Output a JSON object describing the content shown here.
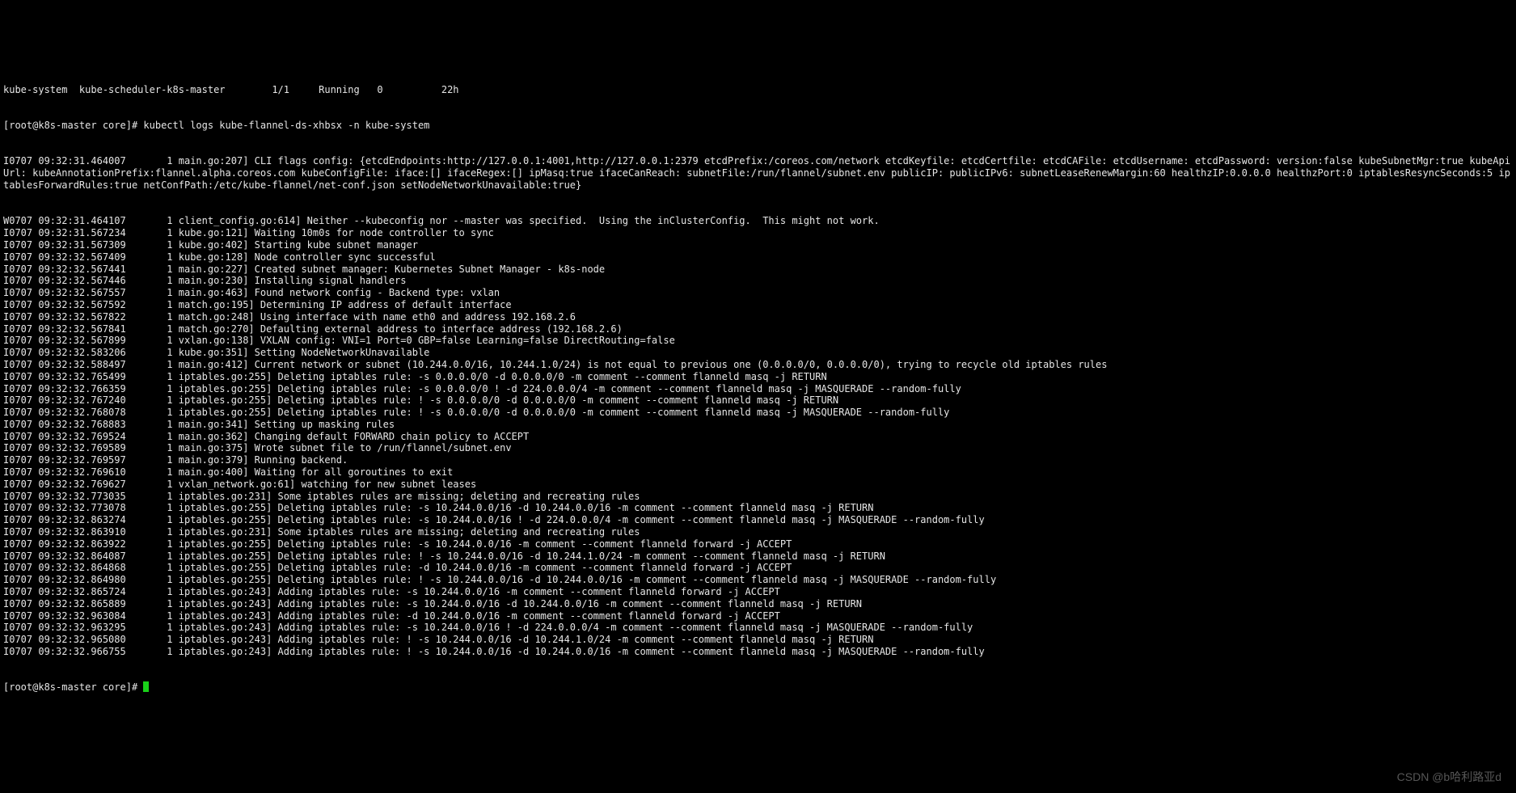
{
  "header": {
    "top_line": "kube-system  kube-scheduler-k8s-master        1/1     Running   0          22h",
    "prompt_command": "[root@k8s-master core]# kubectl logs kube-flannel-ds-xhbsx -n kube-system"
  },
  "cli_flags_block": "I0707 09:32:31.464007       1 main.go:207] CLI flags config: {etcdEndpoints:http://127.0.0.1:4001,http://127.0.0.1:2379 etcdPrefix:/coreos.com/network etcdKeyfile: etcdCertfile: etcdCAFile: etcdUsername: etcdPassword: version:false kubeSubnetMgr:true kubeApiUrl: kubeAnnotationPrefix:flannel.alpha.coreos.com kubeConfigFile: iface:[] ifaceRegex:[] ipMasq:true ifaceCanReach: subnetFile:/run/flannel/subnet.env publicIP: publicIPv6: subnetLeaseRenewMargin:60 healthzIP:0.0.0.0 healthzPort:0 iptablesResyncSeconds:5 iptablesForwardRules:true netConfPath:/etc/kube-flannel/net-conf.json setNodeNetworkUnavailable:true}",
  "log_lines": [
    "W0707 09:32:31.464107       1 client_config.go:614] Neither --kubeconfig nor --master was specified.  Using the inClusterConfig.  This might not work.",
    "I0707 09:32:31.567234       1 kube.go:121] Waiting 10m0s for node controller to sync",
    "I0707 09:32:31.567309       1 kube.go:402] Starting kube subnet manager",
    "I0707 09:32:32.567409       1 kube.go:128] Node controller sync successful",
    "I0707 09:32:32.567441       1 main.go:227] Created subnet manager: Kubernetes Subnet Manager - k8s-node",
    "I0707 09:32:32.567446       1 main.go:230] Installing signal handlers",
    "I0707 09:32:32.567557       1 main.go:463] Found network config - Backend type: vxlan",
    "I0707 09:32:32.567592       1 match.go:195] Determining IP address of default interface",
    "I0707 09:32:32.567822       1 match.go:248] Using interface with name eth0 and address 192.168.2.6",
    "I0707 09:32:32.567841       1 match.go:270] Defaulting external address to interface address (192.168.2.6)",
    "I0707 09:32:32.567899       1 vxlan.go:138] VXLAN config: VNI=1 Port=0 GBP=false Learning=false DirectRouting=false",
    "I0707 09:32:32.583206       1 kube.go:351] Setting NodeNetworkUnavailable",
    "I0707 09:32:32.588497       1 main.go:412] Current network or subnet (10.244.0.0/16, 10.244.1.0/24) is not equal to previous one (0.0.0.0/0, 0.0.0.0/0), trying to recycle old iptables rules",
    "I0707 09:32:32.765499       1 iptables.go:255] Deleting iptables rule: -s 0.0.0.0/0 -d 0.0.0.0/0 -m comment --comment flanneld masq -j RETURN",
    "I0707 09:32:32.766359       1 iptables.go:255] Deleting iptables rule: -s 0.0.0.0/0 ! -d 224.0.0.0/4 -m comment --comment flanneld masq -j MASQUERADE --random-fully",
    "I0707 09:32:32.767240       1 iptables.go:255] Deleting iptables rule: ! -s 0.0.0.0/0 -d 0.0.0.0/0 -m comment --comment flanneld masq -j RETURN",
    "I0707 09:32:32.768078       1 iptables.go:255] Deleting iptables rule: ! -s 0.0.0.0/0 -d 0.0.0.0/0 -m comment --comment flanneld masq -j MASQUERADE --random-fully",
    "I0707 09:32:32.768883       1 main.go:341] Setting up masking rules",
    "I0707 09:32:32.769524       1 main.go:362] Changing default FORWARD chain policy to ACCEPT",
    "I0707 09:32:32.769589       1 main.go:375] Wrote subnet file to /run/flannel/subnet.env",
    "I0707 09:32:32.769597       1 main.go:379] Running backend.",
    "I0707 09:32:32.769610       1 main.go:400] Waiting for all goroutines to exit",
    "I0707 09:32:32.769627       1 vxlan_network.go:61] watching for new subnet leases",
    "I0707 09:32:32.773035       1 iptables.go:231] Some iptables rules are missing; deleting and recreating rules",
    "I0707 09:32:32.773078       1 iptables.go:255] Deleting iptables rule: -s 10.244.0.0/16 -d 10.244.0.0/16 -m comment --comment flanneld masq -j RETURN",
    "I0707 09:32:32.863274       1 iptables.go:255] Deleting iptables rule: -s 10.244.0.0/16 ! -d 224.0.0.0/4 -m comment --comment flanneld masq -j MASQUERADE --random-fully",
    "I0707 09:32:32.863910       1 iptables.go:231] Some iptables rules are missing; deleting and recreating rules",
    "I0707 09:32:32.863922       1 iptables.go:255] Deleting iptables rule: -s 10.244.0.0/16 -m comment --comment flanneld forward -j ACCEPT",
    "I0707 09:32:32.864087       1 iptables.go:255] Deleting iptables rule: ! -s 10.244.0.0/16 -d 10.244.1.0/24 -m comment --comment flanneld masq -j RETURN",
    "I0707 09:32:32.864868       1 iptables.go:255] Deleting iptables rule: -d 10.244.0.0/16 -m comment --comment flanneld forward -j ACCEPT",
    "I0707 09:32:32.864980       1 iptables.go:255] Deleting iptables rule: ! -s 10.244.0.0/16 -d 10.244.0.0/16 -m comment --comment flanneld masq -j MASQUERADE --random-fully",
    "I0707 09:32:32.865724       1 iptables.go:243] Adding iptables rule: -s 10.244.0.0/16 -m comment --comment flanneld forward -j ACCEPT",
    "I0707 09:32:32.865889       1 iptables.go:243] Adding iptables rule: -s 10.244.0.0/16 -d 10.244.0.0/16 -m comment --comment flanneld masq -j RETURN",
    "I0707 09:32:32.963084       1 iptables.go:243] Adding iptables rule: -d 10.244.0.0/16 -m comment --comment flanneld forward -j ACCEPT",
    "I0707 09:32:32.963295       1 iptables.go:243] Adding iptables rule: -s 10.244.0.0/16 ! -d 224.0.0.0/4 -m comment --comment flanneld masq -j MASQUERADE --random-fully",
    "I0707 09:32:32.965080       1 iptables.go:243] Adding iptables rule: ! -s 10.244.0.0/16 -d 10.244.1.0/24 -m comment --comment flanneld masq -j RETURN",
    "I0707 09:32:32.966755       1 iptables.go:243] Adding iptables rule: ! -s 10.244.0.0/16 -d 10.244.0.0/16 -m comment --comment flanneld masq -j MASQUERADE --random-fully"
  ],
  "footer_prompt": "[root@k8s-master core]# ",
  "watermark": "CSDN @b哈利路亚d"
}
